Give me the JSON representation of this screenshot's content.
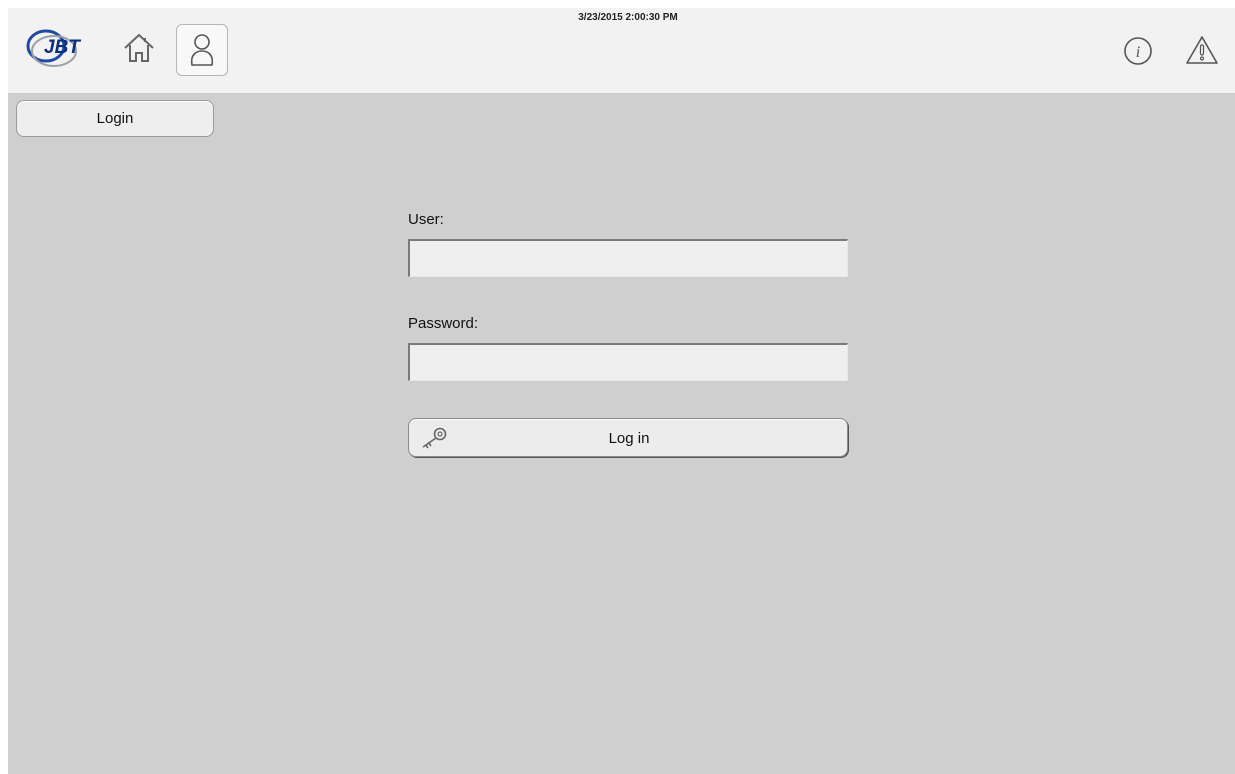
{
  "header": {
    "datetime": "3/23/2015 2:00:30 PM",
    "logo_text": "JBT",
    "icons": [
      "home-icon",
      "user-icon",
      "info-icon",
      "warning-icon"
    ]
  },
  "tabs": [
    {
      "label": "Login",
      "active": true
    }
  ],
  "form": {
    "user_label": "User:",
    "user_value": "",
    "password_label": "Password:",
    "password_value": "",
    "login_button": "Log in"
  },
  "colors": {
    "background": "#cfcfcf",
    "header": "#f2f2f2",
    "field": "#efefef",
    "logo_blue": "#1f4aa3"
  }
}
